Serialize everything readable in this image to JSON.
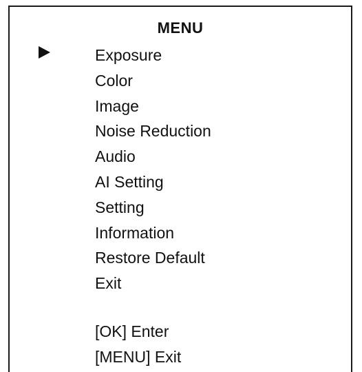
{
  "menu": {
    "title": "MENU",
    "selected_index": 0,
    "items": [
      {
        "label": "Exposure"
      },
      {
        "label": "Color"
      },
      {
        "label": "Image"
      },
      {
        "label": "Noise Reduction"
      },
      {
        "label": "Audio"
      },
      {
        "label": "AI Setting"
      },
      {
        "label": "Setting"
      },
      {
        "label": "Information"
      },
      {
        "label": "Restore Default"
      },
      {
        "label": "Exit"
      }
    ],
    "hints": [
      {
        "text": "[OK] Enter"
      },
      {
        "text": "[MENU] Exit"
      }
    ],
    "cursor_icon": "play-arrow",
    "colors": {
      "text": "#111111",
      "border": "#1a1a1a",
      "background": "#ffffff"
    }
  }
}
